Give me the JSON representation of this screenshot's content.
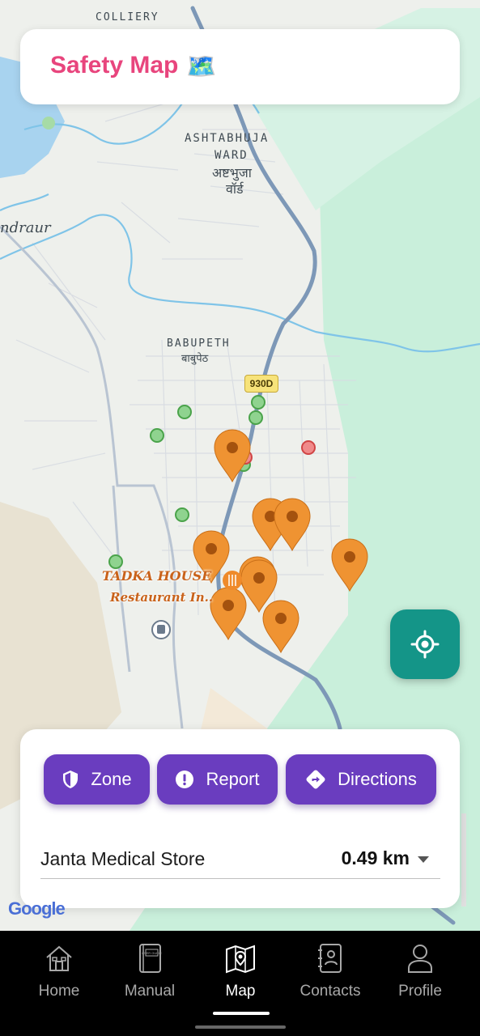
{
  "header": {
    "title": "Safety Map",
    "emoji": "🗺️"
  },
  "map": {
    "labels": {
      "colliery": "COLLIERY",
      "ashtabhuja_1": "ASHTABHUJA",
      "ashtabhuja_2": "WARD",
      "ashtabhuja_hi_1": "अष्टभुजा",
      "ashtabhuja_hi_2": "वॉर्ड",
      "chandraur": "ndraur",
      "babupeth": "BABUPETH",
      "babupeth_hi": "बाबुपेठ",
      "road_badge": "930D",
      "poi_1": "TADKA HOUSE",
      "poi_2": "Restaurant In..",
      "google": "Google"
    },
    "safe_zone_count": 8,
    "danger_zone_count": 2,
    "report_pin_count": 9,
    "colors": {
      "safe": "#5cb85c",
      "danger": "#e05555",
      "pin": "#ef9332",
      "water": "#a8d3ef",
      "forest": "#c6efd9",
      "road": "#7d98b7"
    }
  },
  "locate_button": {
    "icon": "my-location-icon"
  },
  "actions": [
    {
      "label": "Zone",
      "icon": "shield-icon"
    },
    {
      "label": "Report",
      "icon": "alert-icon"
    },
    {
      "label": "Directions",
      "icon": "directions-icon"
    }
  ],
  "destination": {
    "name": "Janta Medical Store",
    "distance": "0.49 km"
  },
  "nav": {
    "items": [
      {
        "label": "Home",
        "icon": "home-icon"
      },
      {
        "label": "Manual",
        "icon": "user-guide-icon"
      },
      {
        "label": "Map",
        "icon": "map-icon"
      },
      {
        "label": "Contacts",
        "icon": "contacts-icon"
      },
      {
        "label": "Profile",
        "icon": "profile-icon"
      }
    ],
    "active": "Map",
    "manual_icon_text": "USER GUIDE"
  }
}
